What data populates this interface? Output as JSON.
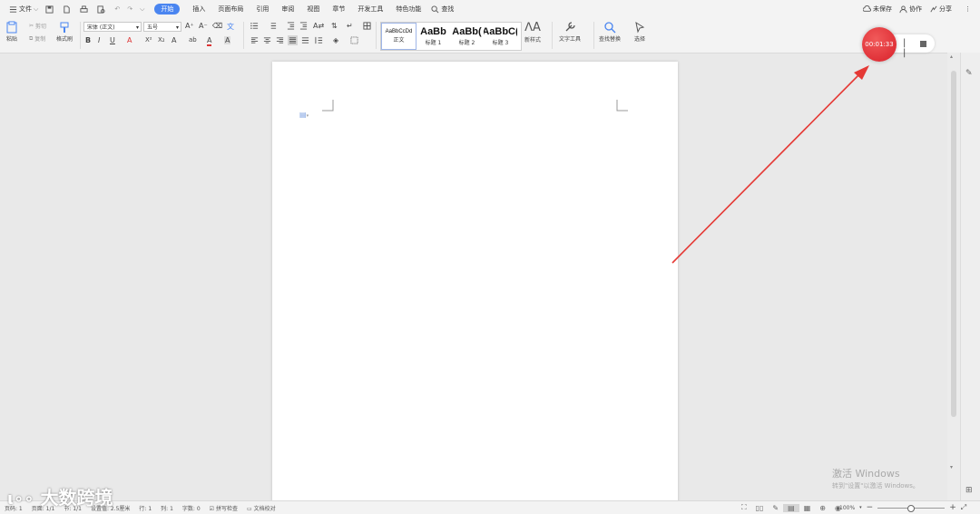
{
  "menubar": {
    "file_label": "文件",
    "tabs": [
      {
        "label": "开始",
        "active": true
      },
      {
        "label": "插入",
        "active": false
      },
      {
        "label": "页面布局",
        "active": false
      },
      {
        "label": "引用",
        "active": false
      },
      {
        "label": "审阅",
        "active": false
      },
      {
        "label": "视图",
        "active": false
      },
      {
        "label": "章节",
        "active": false
      },
      {
        "label": "开发工具",
        "active": false
      },
      {
        "label": "特色功能",
        "active": false
      }
    ],
    "search_label": "查找",
    "unsaved_label": "未保存",
    "collab_label": "协作",
    "share_label": "分享"
  },
  "toolbar": {
    "paste_label": "粘贴",
    "cut_label": "剪切",
    "copy_label": "复制",
    "format_painter_label": "格式刷",
    "font_name": "宋体 (正文)",
    "font_size": "五号",
    "styles": [
      {
        "preview": "AaBbCcDd",
        "label": "正文",
        "small": true,
        "selected": true
      },
      {
        "preview": "AaBb",
        "label": "标题 1",
        "small": false,
        "selected": false
      },
      {
        "preview": "AaBb(",
        "label": "标题 2",
        "small": false,
        "selected": false
      },
      {
        "preview": "AaBbC(",
        "label": "标题 3",
        "small": false,
        "selected": false
      }
    ],
    "new_style_label": "新样式",
    "text_tools_label": "文字工具",
    "find_replace_label": "查找替换",
    "select_label": "选择"
  },
  "recorder": {
    "time": "00:01:33",
    "pause_label": "| |"
  },
  "statusbar": {
    "items": [
      "页码: 1",
      "页面: 1/1",
      "节: 1/1",
      "设置值: 2.5厘米",
      "行: 1",
      "列: 1",
      "字数: 0"
    ],
    "spell_check": "拼写检查",
    "doc_check": "文档校对",
    "zoom": "100%"
  },
  "watermark": {
    "title": "激活 Windows",
    "subtitle": "转到\"设置\"以激活 Windows。"
  },
  "logo_text": "大数跨境",
  "colors": {
    "accent": "#4a85f0",
    "recorder": "#d9202a",
    "arrow": "#e53935"
  }
}
